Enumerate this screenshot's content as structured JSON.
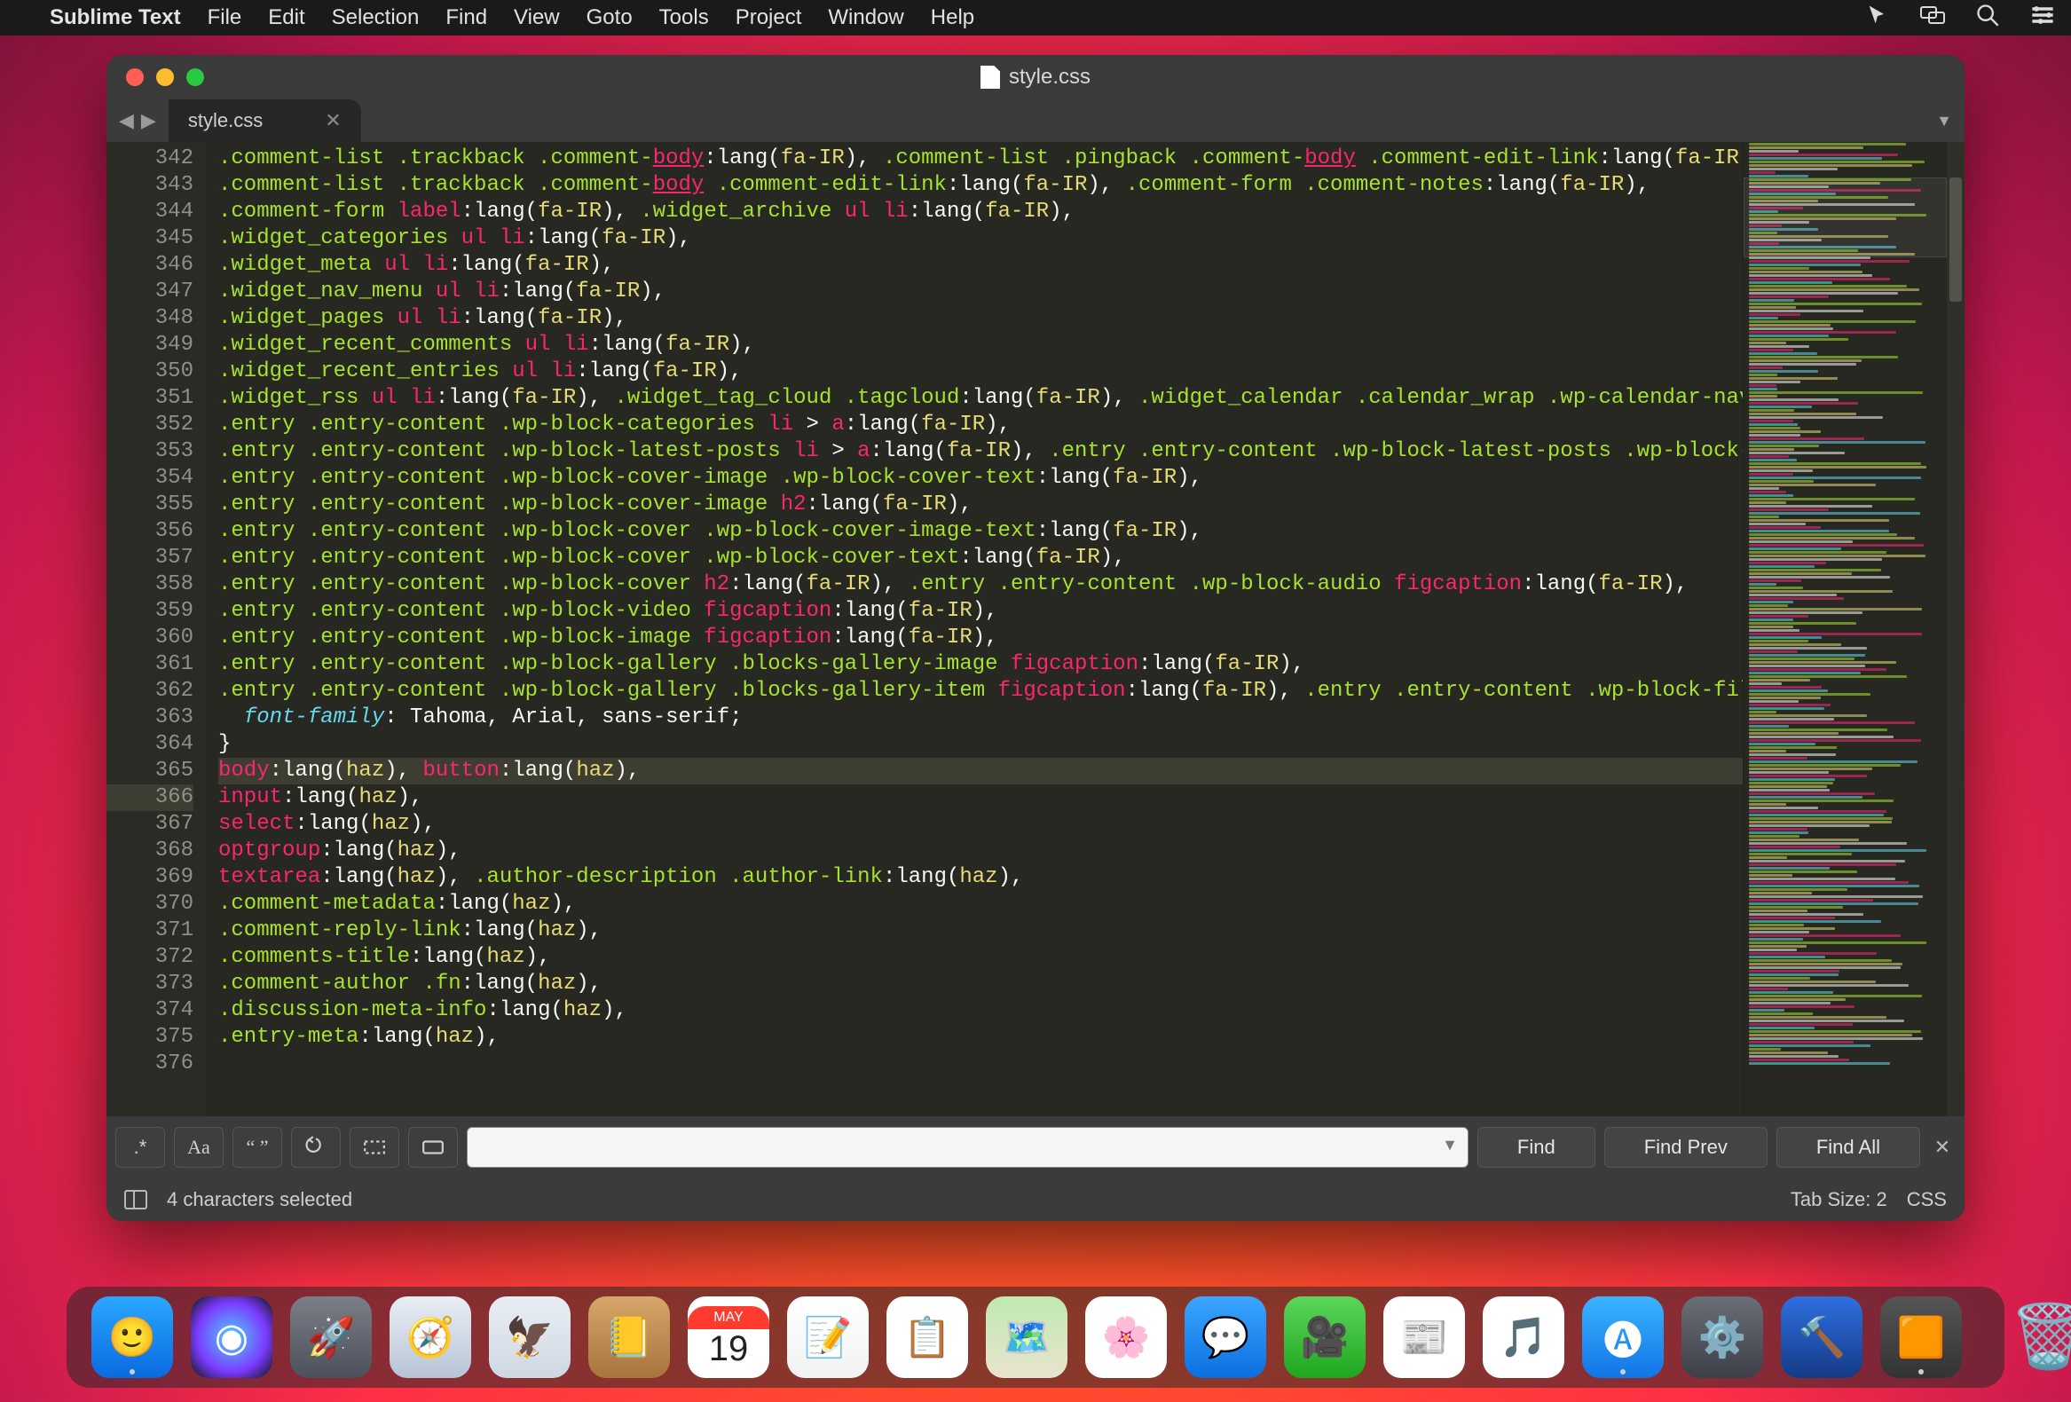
{
  "menubar": {
    "app": "Sublime Text",
    "items": [
      "File",
      "Edit",
      "Selection",
      "Find",
      "View",
      "Goto",
      "Tools",
      "Project",
      "Window",
      "Help"
    ]
  },
  "window": {
    "title": "style.css",
    "tab": "style.css",
    "find": {
      "placeholder": "",
      "find": "Find",
      "findPrev": "Find Prev",
      "findAll": "Find All"
    },
    "status": {
      "msg": "4 characters selected",
      "tab": "Tab Size: 2",
      "syntax": "CSS"
    }
  },
  "gutter_start": 342,
  "gutter_end": 376,
  "highlight_line": 366,
  "code": [
    [
      [
        "s-sel",
        ".comment-list .trackback .comment-"
      ],
      [
        "s-tag u",
        "body"
      ],
      [
        "s-plain",
        ":lang("
      ],
      [
        "s-str",
        "fa-IR"
      ],
      [
        "s-plain",
        "), "
      ],
      [
        "s-sel",
        ".comment-list .pingback .comment-"
      ],
      [
        "s-tag u",
        "body"
      ],
      [
        "s-sel",
        " .comment-edit-link"
      ],
      [
        "s-plain",
        ":lang("
      ],
      [
        "s-str",
        "fa-IR"
      ],
      [
        "s-plain",
        "),"
      ]
    ],
    [
      [
        "s-sel",
        ".comment-list .trackback .comment-"
      ],
      [
        "s-tag u",
        "body"
      ],
      [
        "s-sel",
        " .comment-edit-link"
      ],
      [
        "s-plain",
        ":lang("
      ],
      [
        "s-str",
        "fa-IR"
      ],
      [
        "s-plain",
        "), "
      ],
      [
        "s-sel",
        ".comment-form .comment-notes"
      ],
      [
        "s-plain",
        ":lang("
      ],
      [
        "s-str",
        "fa-IR"
      ],
      [
        "s-plain",
        "),"
      ]
    ],
    [
      [
        "s-sel",
        ".comment-form "
      ],
      [
        "s-tag",
        "label"
      ],
      [
        "s-plain",
        ":lang("
      ],
      [
        "s-str",
        "fa-IR"
      ],
      [
        "s-plain",
        "), "
      ],
      [
        "s-sel",
        ".widget_archive "
      ],
      [
        "s-tag",
        "ul li"
      ],
      [
        "s-plain",
        ":lang("
      ],
      [
        "s-str",
        "fa-IR"
      ],
      [
        "s-plain",
        "),"
      ]
    ],
    [
      [
        "s-sel",
        ".widget_categories "
      ],
      [
        "s-tag",
        "ul li"
      ],
      [
        "s-plain",
        ":lang("
      ],
      [
        "s-str",
        "fa-IR"
      ],
      [
        "s-plain",
        "),"
      ]
    ],
    [
      [
        "s-sel",
        ".widget_meta "
      ],
      [
        "s-tag",
        "ul li"
      ],
      [
        "s-plain",
        ":lang("
      ],
      [
        "s-str",
        "fa-IR"
      ],
      [
        "s-plain",
        "),"
      ]
    ],
    [
      [
        "s-sel",
        ".widget_nav_menu "
      ],
      [
        "s-tag",
        "ul li"
      ],
      [
        "s-plain",
        ":lang("
      ],
      [
        "s-str",
        "fa-IR"
      ],
      [
        "s-plain",
        "),"
      ]
    ],
    [
      [
        "s-sel",
        ".widget_pages "
      ],
      [
        "s-tag",
        "ul li"
      ],
      [
        "s-plain",
        ":lang("
      ],
      [
        "s-str",
        "fa-IR"
      ],
      [
        "s-plain",
        "),"
      ]
    ],
    [
      [
        "s-sel",
        ".widget_recent_comments "
      ],
      [
        "s-tag",
        "ul li"
      ],
      [
        "s-plain",
        ":lang("
      ],
      [
        "s-str",
        "fa-IR"
      ],
      [
        "s-plain",
        "),"
      ]
    ],
    [
      [
        "s-sel",
        ".widget_recent_entries "
      ],
      [
        "s-tag",
        "ul li"
      ],
      [
        "s-plain",
        ":lang("
      ],
      [
        "s-str",
        "fa-IR"
      ],
      [
        "s-plain",
        "),"
      ]
    ],
    [
      [
        "s-sel",
        ".widget_rss "
      ],
      [
        "s-tag",
        "ul li"
      ],
      [
        "s-plain",
        ":lang("
      ],
      [
        "s-str",
        "fa-IR"
      ],
      [
        "s-plain",
        "), "
      ],
      [
        "s-sel",
        ".widget_tag_cloud .tagcloud"
      ],
      [
        "s-plain",
        ":lang("
      ],
      [
        "s-str",
        "fa-IR"
      ],
      [
        "s-plain",
        "), "
      ],
      [
        "s-sel",
        ".widget_calendar .calendar_wrap .wp-calendar-nav"
      ]
    ],
    [
      [
        "s-sel",
        ".entry .entry-content .wp-block-categories "
      ],
      [
        "s-tag",
        "li"
      ],
      [
        "s-plain",
        " > "
      ],
      [
        "s-tag",
        "a"
      ],
      [
        "s-plain",
        ":lang("
      ],
      [
        "s-str",
        "fa-IR"
      ],
      [
        "s-plain",
        "),"
      ]
    ],
    [
      [
        "s-sel",
        ".entry .entry-content .wp-block-latest-posts "
      ],
      [
        "s-tag",
        "li"
      ],
      [
        "s-plain",
        " > "
      ],
      [
        "s-tag",
        "a"
      ],
      [
        "s-plain",
        ":lang("
      ],
      [
        "s-str",
        "fa-IR"
      ],
      [
        "s-plain",
        "), "
      ],
      [
        "s-sel",
        ".entry .entry-content .wp-block-latest-posts .wp-block-"
      ]
    ],
    [
      [
        "s-sel",
        ".entry .entry-content .wp-block-cover-image .wp-block-cover-text"
      ],
      [
        "s-plain",
        ":lang("
      ],
      [
        "s-str",
        "fa-IR"
      ],
      [
        "s-plain",
        "),"
      ]
    ],
    [
      [
        "s-sel",
        ".entry .entry-content .wp-block-cover-image "
      ],
      [
        "s-tag",
        "h2"
      ],
      [
        "s-plain",
        ":lang("
      ],
      [
        "s-str",
        "fa-IR"
      ],
      [
        "s-plain",
        "),"
      ]
    ],
    [
      [
        "s-sel",
        ".entry .entry-content .wp-block-cover .wp-block-cover-image-text"
      ],
      [
        "s-plain",
        ":lang("
      ],
      [
        "s-str",
        "fa-IR"
      ],
      [
        "s-plain",
        "),"
      ]
    ],
    [
      [
        "s-sel",
        ".entry .entry-content .wp-block-cover .wp-block-cover-text"
      ],
      [
        "s-plain",
        ":lang("
      ],
      [
        "s-str",
        "fa-IR"
      ],
      [
        "s-plain",
        "),"
      ]
    ],
    [
      [
        "s-sel",
        ".entry .entry-content .wp-block-cover "
      ],
      [
        "s-tag",
        "h2"
      ],
      [
        "s-plain",
        ":lang("
      ],
      [
        "s-str",
        "fa-IR"
      ],
      [
        "s-plain",
        "), "
      ],
      [
        "s-sel",
        ".entry .entry-content .wp-block-audio "
      ],
      [
        "s-tag",
        "figcaption"
      ],
      [
        "s-plain",
        ":lang("
      ],
      [
        "s-str",
        "fa-IR"
      ],
      [
        "s-plain",
        "),"
      ]
    ],
    [
      [
        "s-sel",
        ".entry .entry-content .wp-block-video "
      ],
      [
        "s-tag",
        "figcaption"
      ],
      [
        "s-plain",
        ":lang("
      ],
      [
        "s-str",
        "fa-IR"
      ],
      [
        "s-plain",
        "),"
      ]
    ],
    [
      [
        "s-sel",
        ".entry .entry-content .wp-block-image "
      ],
      [
        "s-tag",
        "figcaption"
      ],
      [
        "s-plain",
        ":lang("
      ],
      [
        "s-str",
        "fa-IR"
      ],
      [
        "s-plain",
        "),"
      ]
    ],
    [
      [
        "s-sel",
        ".entry .entry-content .wp-block-gallery .blocks-gallery-image "
      ],
      [
        "s-tag",
        "figcaption"
      ],
      [
        "s-plain",
        ":lang("
      ],
      [
        "s-str",
        "fa-IR"
      ],
      [
        "s-plain",
        "),"
      ]
    ],
    [
      [
        "s-sel",
        ".entry .entry-content .wp-block-gallery .blocks-gallery-item "
      ],
      [
        "s-tag",
        "figcaption"
      ],
      [
        "s-plain",
        ":lang("
      ],
      [
        "s-str",
        "fa-IR"
      ],
      [
        "s-plain",
        "), "
      ],
      [
        "s-sel",
        ".entry .entry-content .wp-block-fil"
      ]
    ],
    [
      [
        "s-plain",
        "  "
      ],
      [
        "s-prop",
        "font-family"
      ],
      [
        "s-plain",
        ": Tahoma, Arial, sans-serif;"
      ]
    ],
    [
      [
        "s-plain",
        "}"
      ]
    ],
    [
      [
        "s-plain",
        ""
      ]
    ],
    [
      [
        "s-tag",
        "body"
      ],
      [
        "s-plain",
        ":lang("
      ],
      [
        "s-str",
        "haz"
      ],
      [
        "s-plain",
        "), "
      ],
      [
        "s-tag",
        "button"
      ],
      [
        "s-plain",
        ":lang("
      ],
      [
        "s-str",
        "haz"
      ],
      [
        "s-plain",
        "),"
      ]
    ],
    [
      [
        "s-tag",
        "input"
      ],
      [
        "s-plain",
        ":lang("
      ],
      [
        "s-str",
        "haz"
      ],
      [
        "s-plain",
        "),"
      ]
    ],
    [
      [
        "s-tag",
        "select"
      ],
      [
        "s-plain",
        ":lang("
      ],
      [
        "s-str",
        "haz"
      ],
      [
        "s-plain",
        "),"
      ]
    ],
    [
      [
        "s-tag",
        "optgroup"
      ],
      [
        "s-plain",
        ":lang("
      ],
      [
        "s-str",
        "haz"
      ],
      [
        "s-plain",
        "),"
      ]
    ],
    [
      [
        "s-tag",
        "textarea"
      ],
      [
        "s-plain",
        ":lang("
      ],
      [
        "s-str",
        "haz"
      ],
      [
        "s-plain",
        "), "
      ],
      [
        "s-sel",
        ".author-description .author-link"
      ],
      [
        "s-plain",
        ":lang("
      ],
      [
        "s-str",
        "haz"
      ],
      [
        "s-plain",
        "),"
      ]
    ],
    [
      [
        "s-sel",
        ".comment-metadata"
      ],
      [
        "s-plain",
        ":lang("
      ],
      [
        "s-str",
        "haz"
      ],
      [
        "s-plain",
        "),"
      ]
    ],
    [
      [
        "s-sel",
        ".comment-reply-link"
      ],
      [
        "s-plain",
        ":lang("
      ],
      [
        "s-str",
        "haz"
      ],
      [
        "s-plain",
        "),"
      ]
    ],
    [
      [
        "s-sel",
        ".comments-title"
      ],
      [
        "s-plain",
        ":lang("
      ],
      [
        "s-str",
        "haz"
      ],
      [
        "s-plain",
        "),"
      ]
    ],
    [
      [
        "s-sel",
        ".comment-author .fn"
      ],
      [
        "s-plain",
        ":lang("
      ],
      [
        "s-str",
        "haz"
      ],
      [
        "s-plain",
        "),"
      ]
    ],
    [
      [
        "s-sel",
        ".discussion-meta-info"
      ],
      [
        "s-plain",
        ":lang("
      ],
      [
        "s-str",
        "haz"
      ],
      [
        "s-plain",
        "),"
      ]
    ],
    [
      [
        "s-sel",
        ".entry-meta"
      ],
      [
        "s-plain",
        ":lang("
      ],
      [
        "s-str",
        "haz"
      ],
      [
        "s-plain",
        "),"
      ]
    ]
  ],
  "dock": {
    "apps": [
      {
        "n": "finder",
        "bg": "linear-gradient(#2aa7ff,#0a6adf)",
        "running": true,
        "g": "🙂"
      },
      {
        "n": "siri",
        "bg": "radial-gradient(circle,#4fd1ff,#7a3bff 60%,#111)",
        "g": "◉"
      },
      {
        "n": "launchpad",
        "bg": "linear-gradient(#7a7f88,#4c505a)",
        "g": "🚀"
      },
      {
        "n": "safari",
        "bg": "linear-gradient(#e9eef5,#b7c4d5)",
        "g": "🧭"
      },
      {
        "n": "mail",
        "bg": "linear-gradient(#e9eef5,#cfd7e2)",
        "g": "🦅"
      },
      {
        "n": "contacts",
        "bg": "linear-gradient(#d7a66a,#a7743c)",
        "g": "📒"
      },
      {
        "n": "calendar",
        "bg": "#fff",
        "g": "📅"
      },
      {
        "n": "notes",
        "bg": "linear-gradient(#fff,#f2f2f2)",
        "g": "📝"
      },
      {
        "n": "reminders",
        "bg": "#fff",
        "g": "📋"
      },
      {
        "n": "maps",
        "bg": "linear-gradient(#bfe9b0,#e9e4cf)",
        "g": "🗺️"
      },
      {
        "n": "photos",
        "bg": "#fff",
        "g": "🌸"
      },
      {
        "n": "messages",
        "bg": "linear-gradient(#3ba6ff,#0b6fe0)",
        "g": "💬"
      },
      {
        "n": "facetime",
        "bg": "linear-gradient(#5bd65b,#1fa71f)",
        "g": "🎥"
      },
      {
        "n": "news",
        "bg": "#fff",
        "g": "📰"
      },
      {
        "n": "music",
        "bg": "#fff",
        "g": "🎵"
      },
      {
        "n": "appstore",
        "bg": "linear-gradient(#3bb4ff,#1274e6)",
        "running": true,
        "g": "🅐"
      },
      {
        "n": "preferences",
        "bg": "linear-gradient(#6a6e77,#3d4048)",
        "g": "⚙️"
      },
      {
        "n": "xcode",
        "bg": "linear-gradient(#2e6fe0,#153a86)",
        "g": "🔨"
      },
      {
        "n": "sublime",
        "bg": "linear-gradient(#555,#333)",
        "running": true,
        "g": "🟧"
      }
    ],
    "trash": {
      "n": "trash",
      "g": "🗑️"
    }
  },
  "calendar": {
    "month": "MAY",
    "day": "19"
  }
}
